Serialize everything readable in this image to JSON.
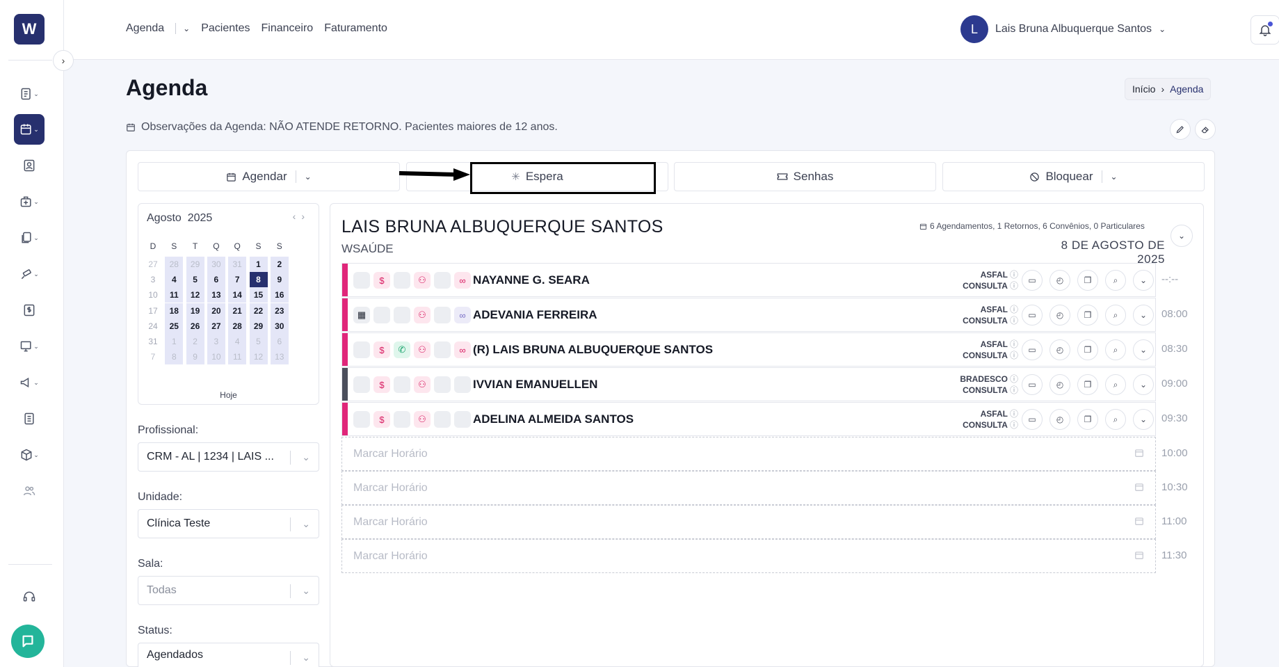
{
  "app": {
    "logo_letter": "W"
  },
  "nav": {
    "agenda": "Agenda",
    "pacientes": "Pacientes",
    "financeiro": "Financeiro",
    "faturamento": "Faturamento"
  },
  "user": {
    "initial": "L",
    "name": "Lais Bruna Albuquerque Santos"
  },
  "page": {
    "title": "Agenda",
    "breadcrumb": {
      "home": "Início",
      "current": "Agenda"
    },
    "observation": "Observações da Agenda: NÃO ATENDE RETORNO. Pacientes maiores de 12 anos."
  },
  "actions": {
    "agendar": "Agendar",
    "espera": "Espera",
    "senhas": "Senhas",
    "bloquear": "Bloquear"
  },
  "calendar": {
    "month": "Agosto",
    "year": "2025",
    "weekdays": [
      "D",
      "S",
      "T",
      "Q",
      "Q",
      "S",
      "S"
    ],
    "weeks": [
      [
        "27",
        "28",
        "29",
        "30",
        "31",
        "1",
        "2"
      ],
      [
        "3",
        "4",
        "5",
        "6",
        "7",
        "8",
        "9"
      ],
      [
        "10",
        "11",
        "12",
        "13",
        "14",
        "15",
        "16"
      ],
      [
        "17",
        "18",
        "19",
        "20",
        "21",
        "22",
        "23"
      ],
      [
        "24",
        "25",
        "26",
        "27",
        "28",
        "29",
        "30"
      ],
      [
        "31",
        "1",
        "2",
        "3",
        "4",
        "5",
        "6"
      ],
      [
        "7",
        "8",
        "9",
        "10",
        "11",
        "12",
        "13"
      ]
    ],
    "selected": "8",
    "today_label": "Hoje"
  },
  "filters": {
    "profissional": {
      "label": "Profissional:",
      "value": "CRM - AL | 1234 | LAIS ..."
    },
    "unidade": {
      "label": "Unidade:",
      "value": "Clínica Teste"
    },
    "sala": {
      "label": "Sala:",
      "value": "Todas"
    },
    "status": {
      "label": "Status:",
      "value": "Agendados"
    }
  },
  "schedule": {
    "doctor": "LAIS BRUNA ALBUQUERQUE SANTOS",
    "unit": "WSAÚDE",
    "summary": "6 Agendamentos, 1 Retornos, 6 Convênios, 0 Particulares",
    "date": "8 DE AGOSTO DE 2025",
    "appointments": [
      {
        "name": "NAYANNE G. SEARA",
        "insurance": "ASFAL",
        "type": "CONSULTA",
        "time": "--:--",
        "color": "#e0267a"
      },
      {
        "name": "ADEVANIA FERREIRA",
        "insurance": "ASFAL",
        "type": "CONSULTA",
        "time": "08:00",
        "color": "#e0267a"
      },
      {
        "name": "(R) LAIS BRUNA ALBUQUERQUE SANTOS",
        "insurance": "ASFAL",
        "type": "CONSULTA",
        "time": "08:30",
        "color": "#e0267a"
      },
      {
        "name": "IVVIAN EMANUELLEN",
        "insurance": "BRADESCO",
        "type": "CONSULTA",
        "time": "09:00",
        "color": "#4b4f5c"
      },
      {
        "name": "ADELINA ALMEIDA SANTOS",
        "insurance": "ASFAL",
        "type": "CONSULTA",
        "time": "09:30",
        "color": "#e0267a"
      }
    ],
    "slots": [
      {
        "label": "Marcar Horário",
        "time": "10:00"
      },
      {
        "label": "Marcar Horário",
        "time": "10:30"
      },
      {
        "label": "Marcar Horário",
        "time": "11:00"
      },
      {
        "label": "Marcar Horário",
        "time": "11:30"
      }
    ]
  }
}
